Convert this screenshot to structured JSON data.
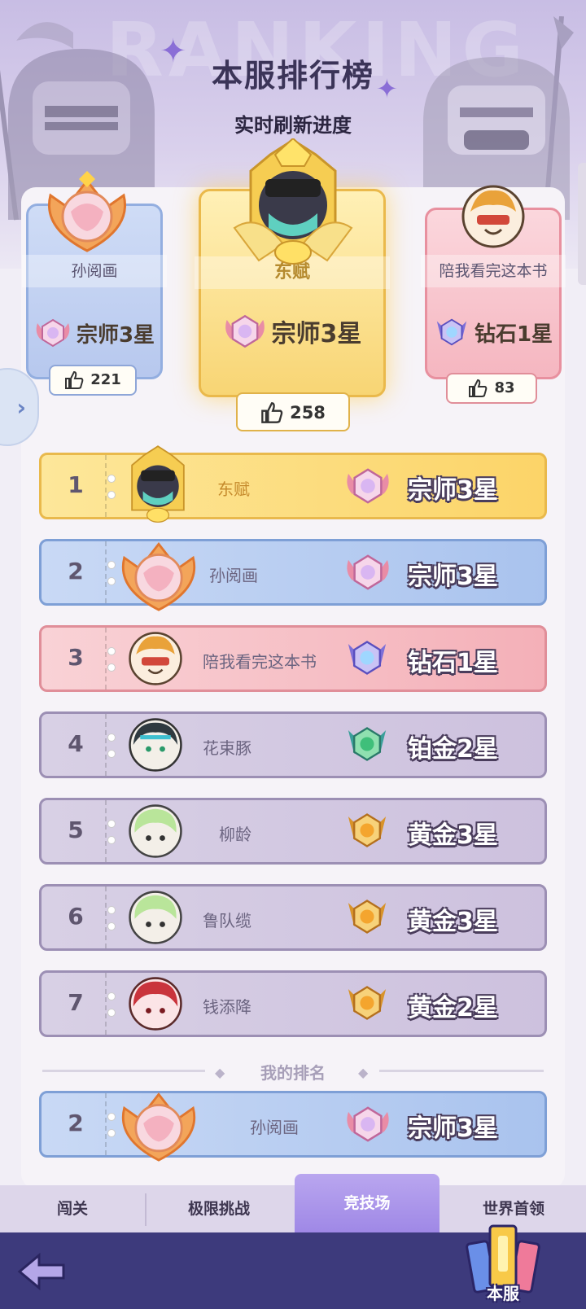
{
  "header": {
    "watermark": "RANKING",
    "title": "本服排行榜",
    "subtitle": "实时刷新进度"
  },
  "podium": {
    "first": {
      "name": "东赋",
      "rank": "宗师3星",
      "likes": "258"
    },
    "second": {
      "name": "孙阅画",
      "rank": "宗师3星",
      "likes": "221"
    },
    "third": {
      "name": "陪我看完这本书",
      "rank": "钻石1星",
      "likes": "83"
    }
  },
  "rows": [
    {
      "rank": "1",
      "name": "东赋",
      "tier": "宗师3星",
      "style": "gold"
    },
    {
      "rank": "2",
      "name": "孙阅画",
      "tier": "宗师3星",
      "style": "blue"
    },
    {
      "rank": "3",
      "name": "陪我看完这本书",
      "tier": "钻石1星",
      "style": "pink"
    },
    {
      "rank": "4",
      "name": "花束豚",
      "tier": "铂金2星",
      "style": "purple"
    },
    {
      "rank": "5",
      "name": "柳龄",
      "tier": "黄金3星",
      "style": "purple"
    },
    {
      "rank": "6",
      "name": "鲁队缆",
      "tier": "黄金3星",
      "style": "purple"
    },
    {
      "rank": "7",
      "name": "钱添降",
      "tier": "黄金2星",
      "style": "purple"
    }
  ],
  "my_rank": {
    "label": "我的排名",
    "rank": "2",
    "name": "孙阅画",
    "tier": "宗师3星"
  },
  "tabs": [
    "闯关",
    "极限挑战",
    "竞技场",
    "世界首领"
  ],
  "active_tab": "竞技场",
  "server_button": "本服",
  "colors": {
    "gold": "#fcd468",
    "blue": "#a9c3ee",
    "pink": "#f4b0b8",
    "purple": "#cdc1de",
    "bottom_bar": "#3d3a7c",
    "active_tab": "#9f88e6"
  },
  "icons": {
    "thumb": "thumbs-up-icon",
    "back": "back-arrow-icon",
    "side": "chevron-right-icon",
    "grandmaster": "grandmaster-badge-icon",
    "diamond": "diamond-badge-icon",
    "platinum": "platinum-badge-icon",
    "gold": "gold-badge-icon"
  }
}
